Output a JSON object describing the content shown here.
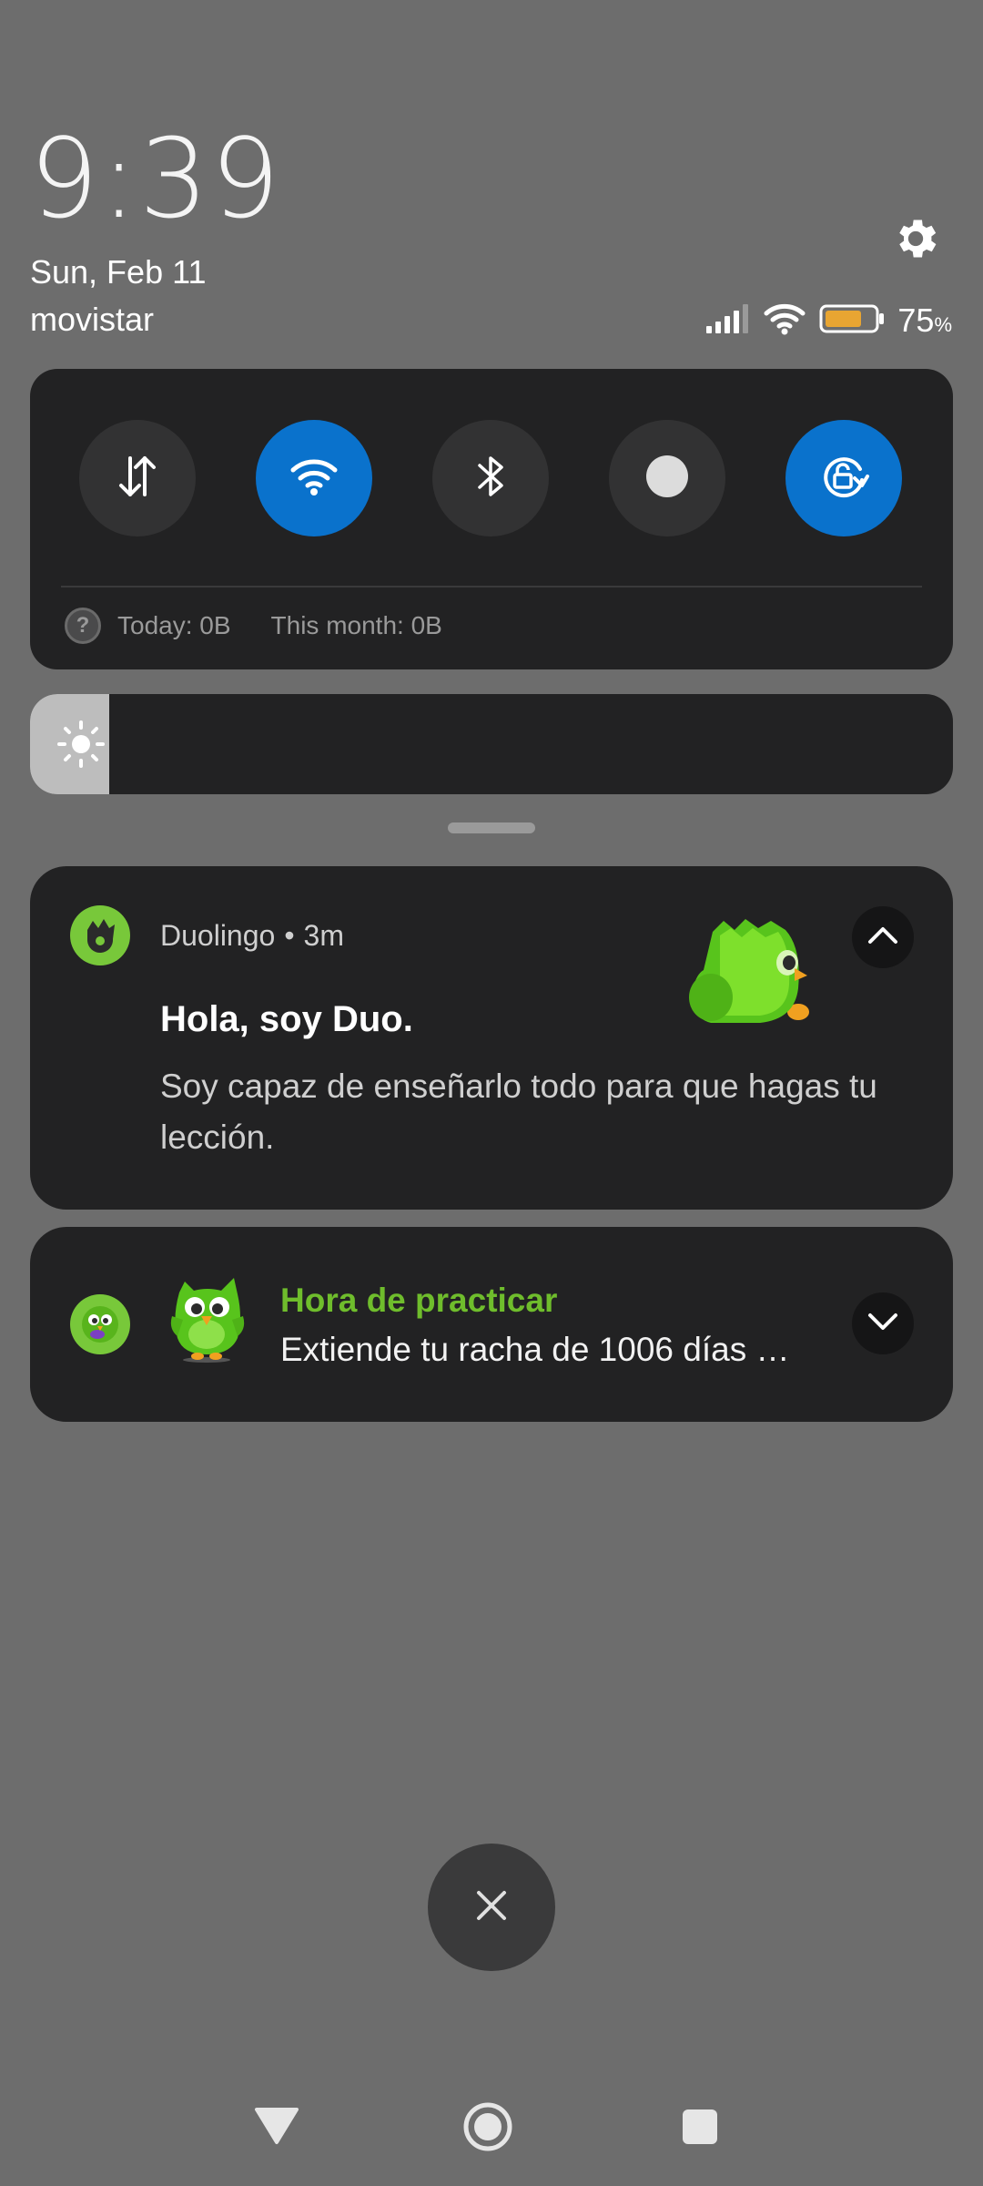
{
  "header": {
    "time": "9:39",
    "date": "Sun, Feb 11",
    "carrier": "movistar",
    "battery_percent": "75",
    "battery_unit": "%",
    "battery_level": 0.75,
    "settings_icon": "gear-icon"
  },
  "quick_settings": {
    "toggles": [
      {
        "name": "mobile-data",
        "icon": "data-transfer-icon",
        "on": false
      },
      {
        "name": "wifi",
        "icon": "wifi-icon",
        "on": true
      },
      {
        "name": "bluetooth",
        "icon": "bluetooth-icon",
        "on": false
      },
      {
        "name": "screen-record",
        "icon": "record-icon",
        "on": false
      },
      {
        "name": "auto-rotate",
        "icon": "rotation-lock-icon",
        "on": true
      }
    ],
    "data_today": "Today: 0B",
    "data_month": "This month: 0B"
  },
  "brightness": {
    "level": 0.086
  },
  "notifications": [
    {
      "app": "Duolingo",
      "separator": "•",
      "time": "3m",
      "title": "Hola, soy Duo.",
      "body": "Soy capaz de enseñarlo todo para que hagas tu lección.",
      "expanded": true
    },
    {
      "title": "Hora de practicar",
      "body": "Extiende tu racha de 1006 días …",
      "expanded": false
    }
  ],
  "colors": {
    "accent": "#0a72cc",
    "panel": "#222223",
    "background": "#6d6d6d",
    "duolingo_green": "#78c83a",
    "title_green": "#6fbd2c",
    "battery": "#e8a532"
  }
}
